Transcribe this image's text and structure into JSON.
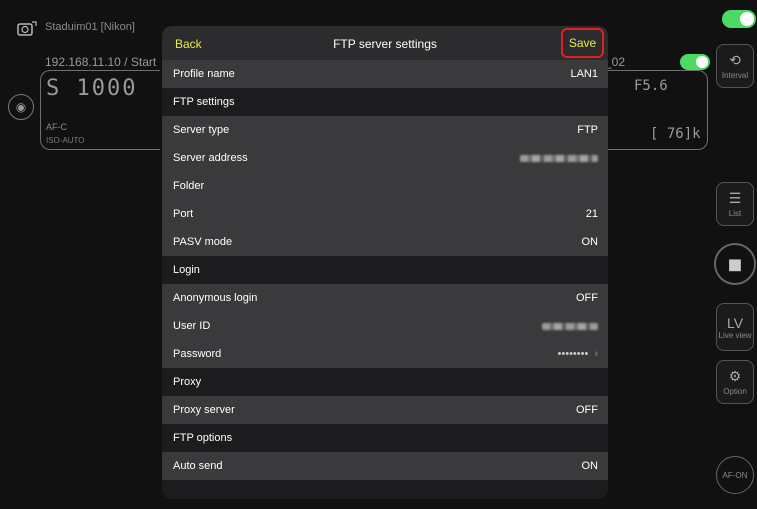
{
  "background": {
    "camera_name": "Staduim01 [Nikon]",
    "connection": "192.168.11.10 / Start",
    "profile_right": "_02",
    "shutter": "1000",
    "af_mode": "AF-C",
    "iso": "ISO-AUTO",
    "fstop": "F5.6",
    "frames": "76",
    "side_buttons": {
      "interval": "Interval",
      "list": "List",
      "lv": "LV",
      "lv_sub": "Live view",
      "option": "Option",
      "afon": "AF-ON"
    }
  },
  "modal": {
    "back_label": "Back",
    "title": "FTP server settings",
    "save_label": "Save",
    "rows": {
      "profile_name": {
        "label": "Profile name",
        "value": "LAN1"
      },
      "ftp_settings_header": "FTP settings",
      "server_type": {
        "label": "Server type",
        "value": "FTP"
      },
      "server_address": {
        "label": "Server address"
      },
      "folder": {
        "label": "Folder"
      },
      "port": {
        "label": "Port",
        "value": "21"
      },
      "pasv_mode": {
        "label": "PASV mode",
        "value": "ON"
      },
      "login_header": "Login",
      "anonymous_login": {
        "label": "Anonymous login",
        "value": "OFF"
      },
      "user_id": {
        "label": "User ID"
      },
      "password": {
        "label": "Password",
        "value": "••••••••"
      },
      "proxy_header": "Proxy",
      "proxy_server": {
        "label": "Proxy server",
        "value": "OFF"
      },
      "ftp_options_header": "FTP options",
      "auto_send": {
        "label": "Auto send",
        "value": "ON"
      }
    }
  },
  "colors": {
    "accent_yellow": "#e8e84a",
    "save_highlight": "#e02020",
    "toggle_on": "#4cd964"
  }
}
